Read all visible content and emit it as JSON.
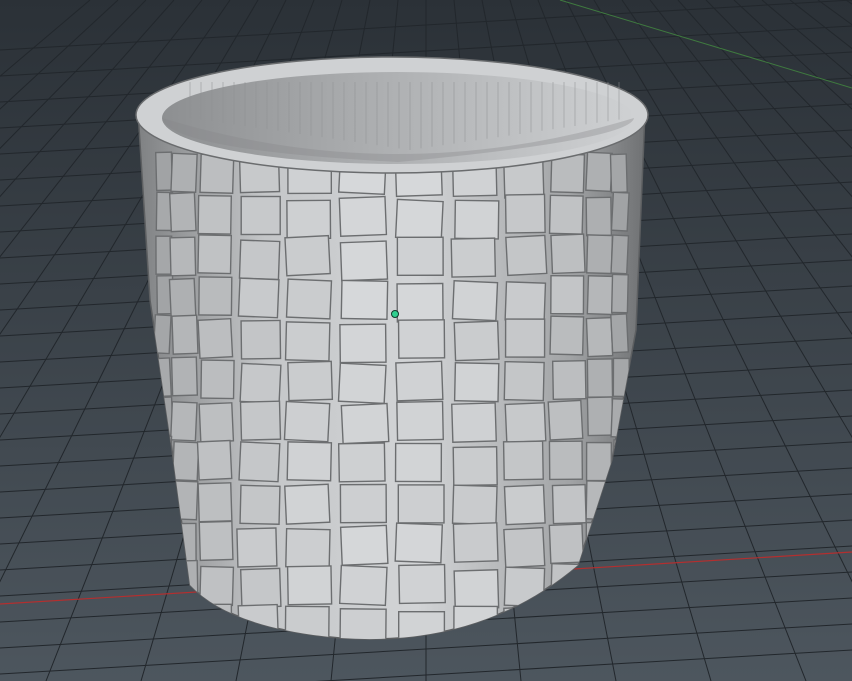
{
  "viewport": {
    "background_top": "#2b3137",
    "background_bottom": "#4d565e",
    "grid_color": "#1f2428",
    "x_axis_color": "#b32f2f",
    "z_axis_color": "#3f7a3f",
    "pivot_color": "#2fcf8f"
  },
  "object": {
    "kind": "cylinder",
    "surface": "tile-mosaic",
    "shell_color": "#b7b9bb",
    "inner_color": "#9a9c9e"
  }
}
